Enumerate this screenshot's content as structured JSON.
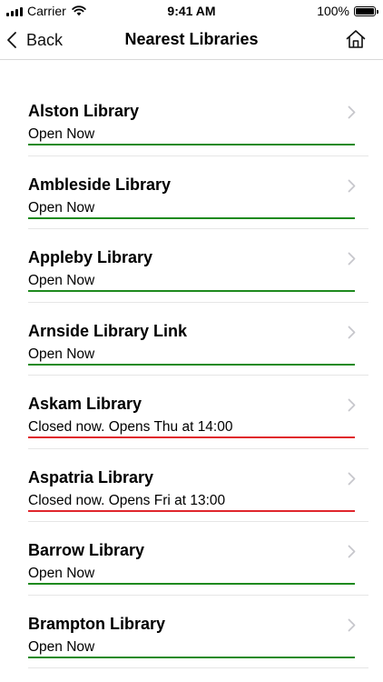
{
  "status_bar": {
    "carrier": "Carrier",
    "time": "9:41 AM",
    "battery": "100%",
    "icons": [
      "signal-icon",
      "wifi-icon",
      "battery-icon"
    ]
  },
  "nav": {
    "back_label": "Back",
    "title": "Nearest Libraries",
    "icons": [
      "chevron-left-icon",
      "home-icon"
    ]
  },
  "colors": {
    "open": "#1e8a1e",
    "closed": "#e0262c",
    "chevron": "#c7c7cc"
  },
  "libraries": [
    {
      "name": "Alston Library",
      "status": "Open Now",
      "state": "open"
    },
    {
      "name": "Ambleside Library",
      "status": "Open Now",
      "state": "open"
    },
    {
      "name": "Appleby Library",
      "status": "Open Now",
      "state": "open"
    },
    {
      "name": "Arnside Library Link",
      "status": "Open Now",
      "state": "open"
    },
    {
      "name": "Askam Library",
      "status": "Closed now. Opens Thu at 14:00",
      "state": "closed"
    },
    {
      "name": "Aspatria Library",
      "status": "Closed now. Opens Fri at 13:00",
      "state": "closed"
    },
    {
      "name": "Barrow Library",
      "status": "Open Now",
      "state": "open"
    },
    {
      "name": "Brampton Library",
      "status": "Open Now",
      "state": "open"
    }
  ]
}
